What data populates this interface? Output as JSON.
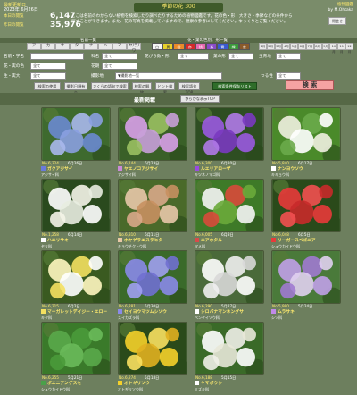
{
  "header": {
    "update_label": "最新更新日",
    "update_date": "2023年 6月26日",
    "count1_label": "本日の閲覧",
    "count1": "6,147",
    "count2_label": "昨日の閲覧",
    "count2": "35,976",
    "logo_text": "季節の花 300",
    "description": "ここは名前のわからない植物を検索したり調べたりするための植物図鑑です。花の色・形・大きさ・季節などの条件から探すことができます。また、花の写真を掲載していますので、観察の参考にしてください。ゆっくりとご覧ください。",
    "right_line1": "植物図鑑",
    "right_line2": "by M.Ohtaka",
    "close_label": "閉会せ"
  },
  "filters": {
    "head_name": "名前一覧",
    "head_color": "花・葉の色別、形一覧",
    "kana": [
      "ア",
      "カ",
      "サ",
      "タ",
      "ナ",
      "ハ",
      "マ",
      "ヤ/ラ/ワ"
    ],
    "colors": [
      {
        "label": "白",
        "color": "#f5f5f5"
      },
      {
        "label": "黄",
        "color": "#e8d22a"
      },
      {
        "label": "橙",
        "color": "#e88a2a"
      },
      {
        "label": "赤",
        "color": "#d42a2a"
      },
      {
        "label": "桃",
        "color": "#e86ab0"
      },
      {
        "label": "紫",
        "color": "#8a4ac8"
      },
      {
        "label": "青",
        "color": "#3a5ad0"
      },
      {
        "label": "緑",
        "color": "#3a9a3a"
      },
      {
        "label": "茶",
        "color": "#8a5a2a"
      }
    ],
    "months": [
      "1月",
      "2月",
      "3月",
      "4月",
      "5月",
      "6月",
      "7月",
      "8月",
      "9月",
      "10月",
      "11月",
      "12月"
    ],
    "row1_label": "名前・学名",
    "row1_value": "",
    "row1_b": "科名",
    "row1_b_value": "全て",
    "row1_c": "花びら数・形",
    "row1_c_value": "全て",
    "row1_d": "葉の形",
    "row1_d_value": "全て",
    "row1_e": "生育地",
    "row1_e_value": "全て",
    "row2_label": "花・実の色",
    "row2_value": "全て",
    "row2_b": "花期",
    "row2_b_value": "全て",
    "row3_label": "生・実大",
    "row3_value": "全て",
    "row3_b": "撮影地",
    "row3_b_value": "▼撮影地一覧",
    "row3_c": "つる性",
    "row3_c_value": "全て",
    "btn1": "検索の使用",
    "btn2": "撮影日順有り",
    "btn3": "さくらの語句で検索",
    "btn4": "検索の解除",
    "btn5": "ヒント検索",
    "btn6": "検索語句TOP",
    "btn7": "検索最新TOP",
    "green_btn": "検索条件保存リスト",
    "search_btn": "検 索"
  },
  "section": {
    "title": "最新掲載",
    "tag": "ひらがな表示TOP"
  },
  "cards": [
    {
      "no": "No.6,324",
      "date": "6月26日",
      "name": "ガクアジサイ",
      "sub": "アジサイ科",
      "marker": "#6a7adb",
      "colors": [
        "#6a8ad0",
        "#a9b8ec",
        "#8aa0e0"
      ],
      "bg": "#3e6a2e"
    },
    {
      "no": "No.6,144",
      "date": "6月23日",
      "name": "ヤエノコアジサイ",
      "sub": "アジサイ科",
      "marker": "#c98ad8",
      "colors": [
        "#d8a0e8",
        "#9ac060",
        "#c8a0d8"
      ],
      "bg": "#3a6028"
    },
    {
      "no": "No.6,300",
      "date": "6月20日",
      "name": "ルエリアローザ",
      "sub": "キツネノマゴ科",
      "marker": "#9a4ae0",
      "colors": [
        "#9a5ae0",
        "#b07ae8",
        "#7a3ac0"
      ],
      "bg": "#2e4e22"
    },
    {
      "no": "No.5,840",
      "date": "6月17日",
      "name": "ナンヨウソウ",
      "sub": "キキョウ科",
      "marker": "#ffffff",
      "colors": [
        "#f0f0e0",
        "#6aaa4a",
        "#ffffff"
      ],
      "bg": "#4a8a2a"
    },
    {
      "no": "No.1,258",
      "date": "6月14日",
      "name": "ハエリサキ",
      "sub": "セリ科",
      "marker": "#ffffff",
      "colors": [
        "#ffffff",
        "#f4f4e8",
        "#e8ece0"
      ],
      "bg": "#2a4a1e"
    },
    {
      "no": "No.6,310",
      "date": "6月11日",
      "name": "ホヤゲラエスラヒタ",
      "sub": "キョウチクトウ科",
      "marker": "#e8c8a8",
      "colors": [
        "#e8c8a8",
        "#d8a888",
        "#c89060"
      ],
      "bg": "#4a6a2a"
    },
    {
      "no": "No.6,005",
      "date": "6月8日",
      "name": "エアホタル",
      "sub": "マメ科",
      "marker": "#d84a4a",
      "colors": [
        "#f4f4f4",
        "#d84a3a",
        "#6aaa3a"
      ],
      "bg": "#3e7a28"
    },
    {
      "no": "No.6,048",
      "date": "6月5日",
      "name": "リーガースベゴニア",
      "sub": "シュウカイドウ科",
      "marker": "#e83a3a",
      "colors": [
        "#e83a3a",
        "#f25050",
        "#c82a2a"
      ],
      "bg": "#2a4a1a"
    },
    {
      "no": "No.6,215",
      "date": "6月2日",
      "name": "マーガレットデイジー・エロー",
      "sub": "キク科",
      "marker": "#f4e060",
      "colors": [
        "#fff6c0",
        "#f4e060",
        "#ffffff"
      ],
      "bg": "#3a5a20"
    },
    {
      "no": "No.6,281",
      "date": "5月30日",
      "name": "セイヨウマツムシソウ",
      "sub": "スイカズラ科",
      "marker": "#8a8ae8",
      "colors": [
        "#8a8ae8",
        "#a0a0f0",
        "#7070d0"
      ],
      "bg": "#3a6a2a"
    },
    {
      "no": "No.6,290",
      "date": "5月27日",
      "name": "シロバナマンネングサ",
      "sub": "ベンケイソウ科",
      "marker": "#ffffff",
      "colors": [
        "#ffffff",
        "#f0f0f0",
        "#d8d8d8"
      ],
      "bg": "#4a6a3a"
    },
    {
      "no": "No.5,990",
      "date": "5月24日",
      "name": "ムラサキ",
      "sub": "シソ科",
      "marker": "#c08ae8",
      "colors": [
        "#c0a0e8",
        "#a07ad0",
        "#e0d0f0"
      ],
      "bg": "#4a7a3a"
    },
    {
      "no": "No.6,255",
      "date": "5月21日",
      "name": "ポエニアンゲスセ",
      "sub": "シュウカイドウ科",
      "marker": "#4aa04a",
      "colors": [
        "#5aa84a",
        "#4a9a3a",
        "#6aba5a"
      ],
      "bg": "#3a7a2a"
    },
    {
      "no": "No.6,274",
      "date": "5月18日",
      "name": "オトギリソウ",
      "sub": "オトギリソウ科",
      "marker": "#f4d02a",
      "colors": [
        "#f4d02a",
        "#f8e060",
        "#e0b020"
      ],
      "bg": "#2a4a1a"
    },
    {
      "no": "No.6,188",
      "date": "5月15日",
      "name": "ヤマボウシ",
      "sub": "ミズキ科",
      "marker": "#ffffff",
      "colors": [
        "#ffffff",
        "#f0f0e8",
        "#e8e8d8"
      ],
      "bg": "#3a6a28"
    }
  ]
}
